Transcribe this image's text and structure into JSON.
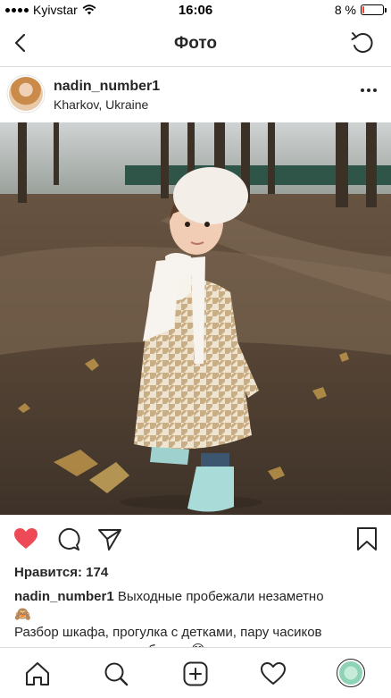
{
  "status_bar": {
    "carrier": "Kyivstar",
    "time": "16:06",
    "battery_percent": "8 %",
    "battery_level": 0.08,
    "battery_color": "#ff3b30"
  },
  "nav": {
    "title": "Фото",
    "back_icon": "chevron-left-icon",
    "refresh_icon": "refresh-icon"
  },
  "post": {
    "username": "nadin_number1",
    "location": "Kharkov, Ukraine",
    "likes": "Нравится: 174",
    "caption_user": "nadin_number1",
    "caption_text": " Выходные пробежали незаметно",
    "caption_emoji": "🙈",
    "caption_line2": "Разбор шкафа, прогулка с детками, пару часиков",
    "caption_line3": "у плиты - ну все как обычно 😊",
    "liked": true,
    "like_color": "#ed4956"
  },
  "tabs": [
    "home-icon",
    "search-icon",
    "new-post-icon",
    "activity-heart-icon",
    "profile-avatar-icon"
  ]
}
